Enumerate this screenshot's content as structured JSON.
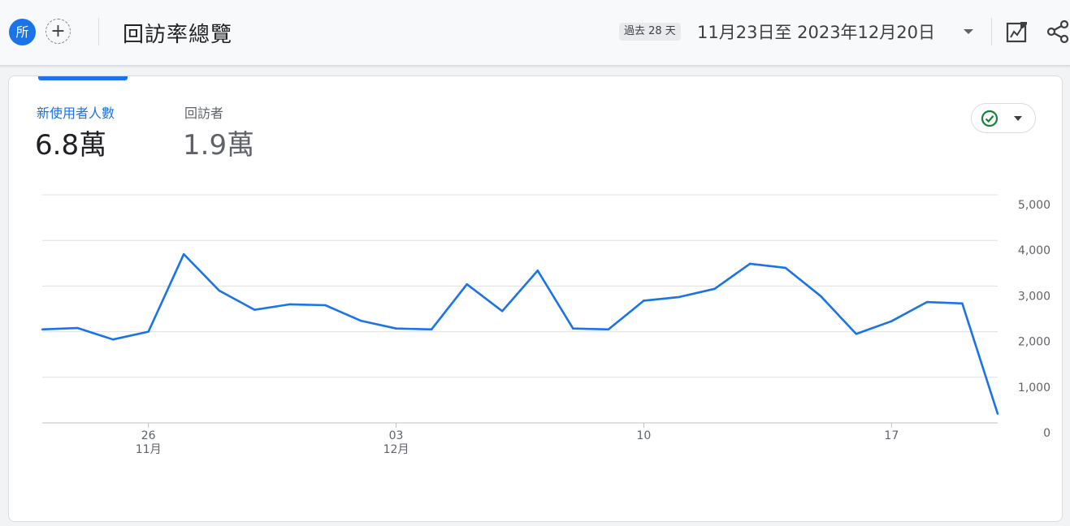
{
  "header": {
    "avatar_label": "所",
    "add_label": "+",
    "page_title": "回訪率總覽",
    "date_chip": "過去 28 天",
    "date_range": "11月23日至 2023年12月20日"
  },
  "metrics": [
    {
      "label": "新使用者人數",
      "value": "6.8萬",
      "selected": true
    },
    {
      "label": "回訪者",
      "value": "1.9萬",
      "selected": false
    }
  ],
  "status_icon": "check-circle-icon",
  "colors": {
    "accent": "#1a73e8",
    "line": "#1a73e8",
    "status_green": "#188038"
  },
  "chart_data": {
    "type": "line",
    "x": [
      "11-23",
      "11-24",
      "11-25",
      "11-26",
      "11-27",
      "11-28",
      "11-29",
      "11-30",
      "12-01",
      "12-02",
      "12-03",
      "12-04",
      "12-05",
      "12-06",
      "12-07",
      "12-08",
      "12-09",
      "12-10",
      "12-11",
      "12-12",
      "12-13",
      "12-14",
      "12-15",
      "12-16",
      "12-17",
      "12-18",
      "12-19",
      "12-20"
    ],
    "series": [
      {
        "values": [
          2050,
          2080,
          1830,
          2000,
          3700,
          2900,
          2480,
          2600,
          2580,
          2240,
          2070,
          2050,
          3040,
          2450,
          3340,
          2070,
          2050,
          2680,
          2760,
          2940,
          3490,
          3400,
          2780,
          1950,
          2230,
          2650,
          2620,
          200
        ]
      }
    ],
    "ylim": [
      0,
      5000
    ],
    "y_ticks": [
      "5,000",
      "4,000",
      "3,000",
      "2,000",
      "1,000",
      "0"
    ],
    "y_tick_values": [
      5000,
      4000,
      3000,
      2000,
      1000,
      0
    ],
    "x_ticks": [
      {
        "day": "26",
        "month": "11月",
        "index": 3
      },
      {
        "day": "03",
        "month": "12月",
        "index": 10
      },
      {
        "day": "10",
        "month": "",
        "index": 17
      },
      {
        "day": "17",
        "month": "",
        "index": 24
      }
    ],
    "grid": true,
    "y_axis_side": "right"
  }
}
